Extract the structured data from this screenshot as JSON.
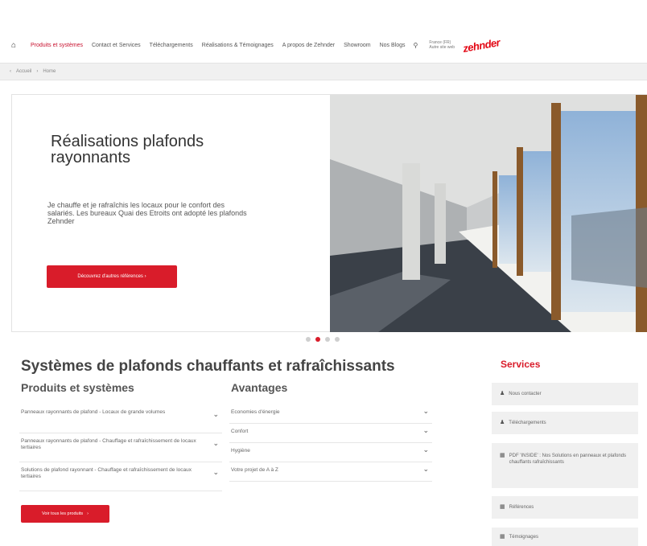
{
  "nav": {
    "home_icon": "home-icon",
    "items": [
      {
        "label": "Produits et systèmes",
        "active": true
      },
      {
        "label": "Contact et Services",
        "active": false
      },
      {
        "label": "Téléchargements",
        "active": false
      },
      {
        "label": "Réalisations & Témoignages",
        "active": false
      },
      {
        "label": "A propos de Zehnder",
        "active": false
      },
      {
        "label": "Showroom",
        "active": false
      },
      {
        "label": "Nos Blogs",
        "active": false
      }
    ],
    "search_icon": "search-icon",
    "country_line1": "France (FR)",
    "country_line2": "Autre site web",
    "logo": "zehnder"
  },
  "breadcrumb": {
    "items": [
      "Accueil",
      "Home"
    ]
  },
  "hero": {
    "title": "Réalisations plafonds rayonnants",
    "text": "Je chauffe et je rafraîchis les locaux pour le confort des salariés. Les bureaux Quai des Etroits ont adopté les plafonds Zehnder",
    "button_label": "Découvrez d'autres références",
    "slides_total": 4,
    "active_slide": 2
  },
  "main": {
    "title": "Systèmes de plafonds chauffants et rafraîchissants",
    "products_heading": "Produits et systèmes",
    "products": [
      "Panneaux rayonnants de plafond - Locaux de grande volumes",
      "Panneaux rayonnants de plafond - Chauffage et rafraîchissement de locaux tertiaires",
      "Solutions de plafond rayonnant - Chauffage et rafraîchissement de locaux tertiaires"
    ],
    "advantages_heading": "Avantages",
    "advantages": [
      "Economies d'énergie",
      "Confort",
      "Hygiène",
      "Votre projet de A à Z"
    ],
    "products_button": "Voir tous les produits"
  },
  "services": {
    "title": "Services",
    "items": [
      {
        "label": "Nous contacter",
        "icon": "person-icon"
      },
      {
        "label": "Téléchargements",
        "icon": "person-icon"
      },
      {
        "label": "PDF 'INSIDE' : Nos Solutions en panneaux et plafonds chauffants rafraîchissants",
        "icon": "grid-icon"
      },
      {
        "label": "Références",
        "icon": "grid-icon"
      },
      {
        "label": "Témoignages",
        "icon": "grid-icon"
      }
    ]
  },
  "colors": {
    "accent": "#d91c2a",
    "breadcrumb_bg": "#f0f0f0",
    "service_bg": "#f0f0f0"
  }
}
